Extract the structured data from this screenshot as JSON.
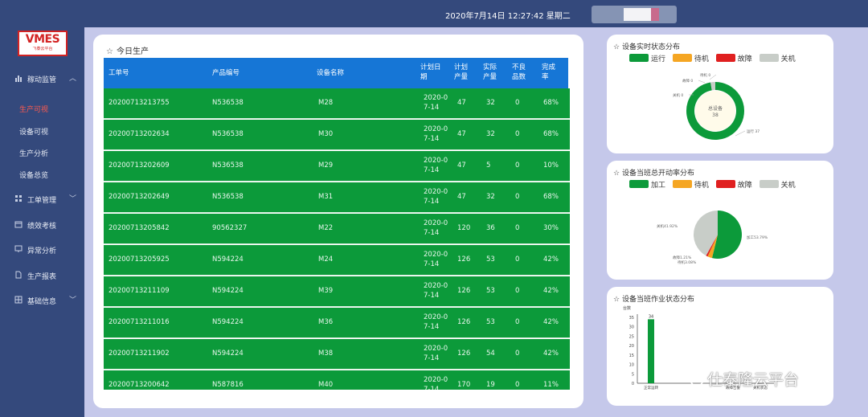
{
  "header": {
    "datetime": "2020年7月14日 12:27:42 星期二"
  },
  "logo": {
    "brand": "VMES",
    "sub": "飞泰云平台"
  },
  "sidebar": {
    "items": [
      {
        "label": "稼动监管",
        "icon": "bar-chart-icon",
        "expanded": true
      },
      {
        "label": "工单管理",
        "icon": "grid-icon",
        "expanded": false
      },
      {
        "label": "绩效考核",
        "icon": "calendar-icon"
      },
      {
        "label": "异常分析",
        "icon": "monitor-icon"
      },
      {
        "label": "生产报表",
        "icon": "document-icon"
      },
      {
        "label": "基础信息",
        "icon": "table-icon",
        "expanded": false
      }
    ],
    "subitems": [
      {
        "label": "生产可视",
        "active": true
      },
      {
        "label": "设备可视"
      },
      {
        "label": "生产分析"
      },
      {
        "label": "设备总览"
      }
    ]
  },
  "production": {
    "title": "今日生产",
    "columns": [
      "工单号",
      "产品编号",
      "设备名称",
      "计划日期",
      "计划产量",
      "实际产量",
      "不良品数",
      "完成率"
    ],
    "column_wrapped": [
      [
        "工单号"
      ],
      [
        "产品编号"
      ],
      [
        "设备名称"
      ],
      [
        "计划日",
        "期"
      ],
      [
        "计划",
        "产量"
      ],
      [
        "实际",
        "产量"
      ],
      [
        "不良",
        "品数"
      ],
      [
        "完成",
        "率"
      ]
    ],
    "rows": [
      {
        "order": "20200713213755",
        "product": "N536538",
        "device": "M28",
        "date1": "2020-0",
        "date2": "7-14",
        "plan": "47",
        "actual": "32",
        "defect": "0",
        "rate": "68%"
      },
      {
        "order": "20200713202634",
        "product": "N536538",
        "device": "M30",
        "date1": "2020-0",
        "date2": "7-14",
        "plan": "47",
        "actual": "32",
        "defect": "0",
        "rate": "68%"
      },
      {
        "order": "20200713202609",
        "product": "N536538",
        "device": "M29",
        "date1": "2020-0",
        "date2": "7-14",
        "plan": "47",
        "actual": "5",
        "defect": "0",
        "rate": "10%"
      },
      {
        "order": "20200713202649",
        "product": "N536538",
        "device": "M31",
        "date1": "2020-0",
        "date2": "7-14",
        "plan": "47",
        "actual": "32",
        "defect": "0",
        "rate": "68%"
      },
      {
        "order": "20200713205842",
        "product": "90562327",
        "device": "M22",
        "date1": "2020-0",
        "date2": "7-14",
        "plan": "120",
        "actual": "36",
        "defect": "0",
        "rate": "30%"
      },
      {
        "order": "20200713205925",
        "product": "N594224",
        "device": "M24",
        "date1": "2020-0",
        "date2": "7-14",
        "plan": "126",
        "actual": "53",
        "defect": "0",
        "rate": "42%"
      },
      {
        "order": "20200713211109",
        "product": "N594224",
        "device": "M39",
        "date1": "2020-0",
        "date2": "7-14",
        "plan": "126",
        "actual": "53",
        "defect": "0",
        "rate": "42%"
      },
      {
        "order": "20200713211016",
        "product": "N594224",
        "device": "M36",
        "date1": "2020-0",
        "date2": "7-14",
        "plan": "126",
        "actual": "53",
        "defect": "0",
        "rate": "42%"
      },
      {
        "order": "20200713211902",
        "product": "N594224",
        "device": "M38",
        "date1": "2020-0",
        "date2": "7-14",
        "plan": "126",
        "actual": "54",
        "defect": "0",
        "rate": "42%"
      },
      {
        "order": "20200713200642",
        "product": "N587816",
        "device": "M40",
        "date1": "2020-0",
        "date2": "7-14",
        "plan": "170",
        "actual": "19",
        "defect": "0",
        "rate": "11%"
      }
    ]
  },
  "colors": {
    "header_bg": "#34497c",
    "table_head": "#1676d6",
    "row_green": "#0c9a3a",
    "run": "#0c9a3a",
    "idle": "#f5a623",
    "fault": "#e02020",
    "off": "#c8cdc8"
  },
  "chart_data": [
    {
      "type": "pie",
      "title": "设备实时状态分布",
      "legend": [
        "运行",
        "待机",
        "故障",
        "关机"
      ],
      "center_label": "总设备",
      "center_value": "38",
      "slices": [
        {
          "name": "运行",
          "value": 37,
          "label": "运行 37"
        },
        {
          "name": "待机",
          "value": 0,
          "label": "待机 0"
        },
        {
          "name": "故障",
          "value": 0,
          "label": "故障 0"
        },
        {
          "name": "关机",
          "value": 1,
          "label": "关机 0"
        }
      ],
      "label_texts": [
        "待机 0",
        "故障 0",
        "关机 0",
        "运行 37"
      ]
    },
    {
      "type": "pie",
      "title": "设备当班总开动率分布",
      "legend": [
        "加工",
        "待机",
        "故障",
        "关机"
      ],
      "slices": [
        {
          "name": "加工",
          "value": 53.79,
          "label": "加工53.79%"
        },
        {
          "name": "待机",
          "value": 3.08,
          "label": "待机3.08%"
        },
        {
          "name": "故障",
          "value": 1.21,
          "label": "故障1.21%"
        },
        {
          "name": "关机",
          "value": 41.92,
          "label": "关机41.92%"
        }
      ]
    },
    {
      "type": "bar",
      "title": "设备当班作业状态分布",
      "ylabel": "台数",
      "ylim": [
        0,
        35
      ],
      "yticks": [
        0,
        5,
        10,
        15,
        20,
        25,
        30,
        35
      ],
      "categories": [
        "正常运转",
        "",
        "",
        "故障告警",
        "关机状态"
      ],
      "values": [
        34,
        0,
        0,
        0,
        0
      ],
      "data_labels": [
        "34"
      ]
    }
  ],
  "watermark": "仕泰隆云平台"
}
